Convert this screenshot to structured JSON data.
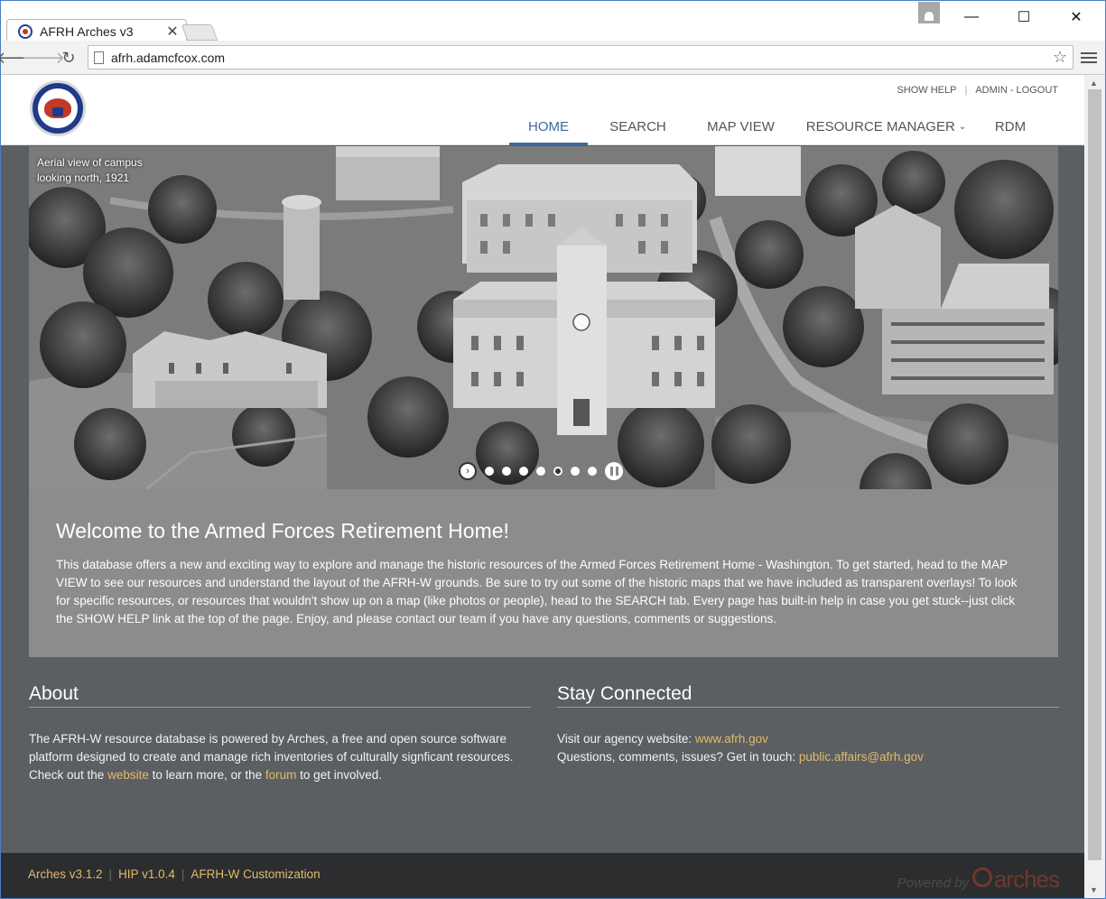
{
  "browser": {
    "tab_title": "AFRH Arches v3",
    "tab_close": "✕",
    "url": "afrh.adamcfcox.com",
    "back_glyph": "🡐",
    "forward_glyph": "🡒",
    "reload_glyph": "↻",
    "star_glyph": "☆",
    "minimize_glyph": "—",
    "maximize_glyph": "☐",
    "close_glyph": "✕"
  },
  "header": {
    "show_help": "SHOW HELP",
    "admin_logout": "ADMIN - LOGOUT",
    "nav": [
      {
        "label": "HOME",
        "active": true
      },
      {
        "label": "SEARCH"
      },
      {
        "label": "MAP VIEW"
      },
      {
        "label": "RESOURCE MANAGER"
      },
      {
        "label": "RDM"
      }
    ],
    "dropdown_caret": "⌄"
  },
  "hero": {
    "caption_line1": "Aerial view of campus",
    "caption_line2": "looking north, 1921",
    "slide_count": 8,
    "current_slide": 5,
    "play_glyph": "›"
  },
  "welcome": {
    "title": "Welcome to the Armed Forces Retirement Home!",
    "body": "This database offers a new and exciting way to explore and manage the historic resources of the Armed Forces Retirement Home - Washington. To get started, head to the MAP VIEW to see our resources and understand the layout of the AFRH-W grounds. Be sure to try out some of the historic maps that we have included as transparent overlays! To look for specific resources, or resources that wouldn't show up on a map (like photos or people), head to the SEARCH tab. Every page has built-in help in case you get stuck--just click the SHOW HELP link at the top of the page. Enjoy, and please contact our team if you have any questions, comments or suggestions."
  },
  "about": {
    "title": "About",
    "text_1": "The AFRH-W resource database is powered by Arches, a free and open source software platform designed to create and manage rich inventories of culturally signficant resources. Check out the ",
    "link_website": "website",
    "text_2": " to learn more, or the ",
    "link_forum": "forum",
    "text_3": " to get involved."
  },
  "stay_connected": {
    "title": "Stay Connected",
    "line1_text": "Visit our agency website: ",
    "line1_link": "www.afrh.gov",
    "line2_text": "Questions, comments, issues? Get in touch: ",
    "line2_link": "public.affairs@afrh.gov"
  },
  "footer": {
    "links": [
      "Arches v3.1.2",
      "HIP v1.0.4",
      "AFRH-W Customization"
    ],
    "powered_by": "Powered by",
    "brand": "arches"
  },
  "colors": {
    "accent_nav": "#3d6a9e",
    "link": "#e1bc68",
    "page_bg": "#5b5e62",
    "welcome_bg": "#8c8c8c",
    "footer_bg": "#2c2d2f"
  }
}
